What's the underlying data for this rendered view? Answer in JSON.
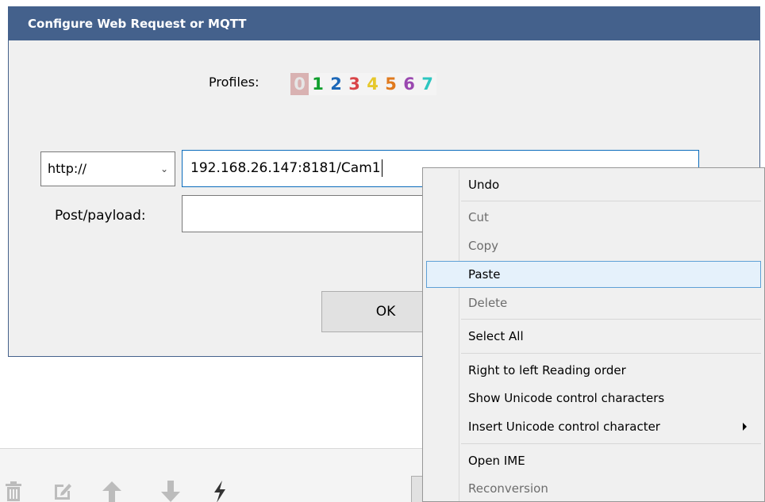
{
  "dialog": {
    "title": "Configure Web Request or MQTT",
    "profiles_label": "Profiles:",
    "profiles": [
      "0",
      "1",
      "2",
      "3",
      "4",
      "5",
      "6",
      "7"
    ],
    "scheme_value": "http://",
    "url_value": "192.168.26.147:8181/Cam1",
    "payload_label": "Post/payload:",
    "payload_value": "",
    "ok_label": "OK"
  },
  "context_menu": {
    "items": [
      {
        "label": "Undo",
        "enabled": true
      },
      {
        "label": "Cut",
        "enabled": false
      },
      {
        "label": "Copy",
        "enabled": false
      },
      {
        "label": "Paste",
        "enabled": true,
        "highlighted": true
      },
      {
        "label": "Delete",
        "enabled": false
      },
      {
        "label": "Select All",
        "enabled": true
      },
      {
        "label": "Right to left Reading order",
        "enabled": true
      },
      {
        "label": "Show Unicode control characters",
        "enabled": true
      },
      {
        "label": "Insert Unicode control character",
        "enabled": true,
        "has_submenu": true
      },
      {
        "label": "Open IME",
        "enabled": true
      },
      {
        "label": "Reconversion",
        "enabled": false
      }
    ]
  },
  "toolbar_icons": [
    "trash-icon",
    "edit-icon",
    "arrow-up-icon",
    "arrow-down-icon",
    "lightning-icon"
  ],
  "colors": {
    "title_bar": "#44618c",
    "input_focus_border": "#0b6cbc",
    "menu_highlight_bg": "#e5f1fb",
    "menu_highlight_border": "#5ea0d6"
  }
}
